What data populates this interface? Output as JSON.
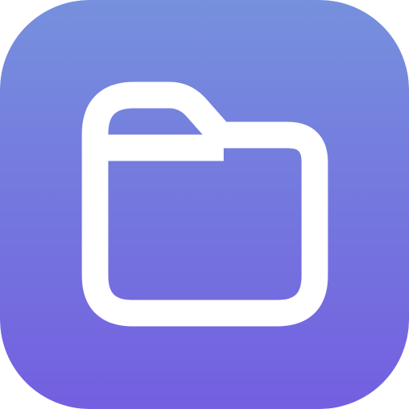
{
  "app_icon": {
    "glyph": "folder-icon",
    "background_gradient": {
      "top": "#7690DD",
      "bottom": "#735FE0"
    },
    "glyph_color": "#FFFFFF"
  }
}
